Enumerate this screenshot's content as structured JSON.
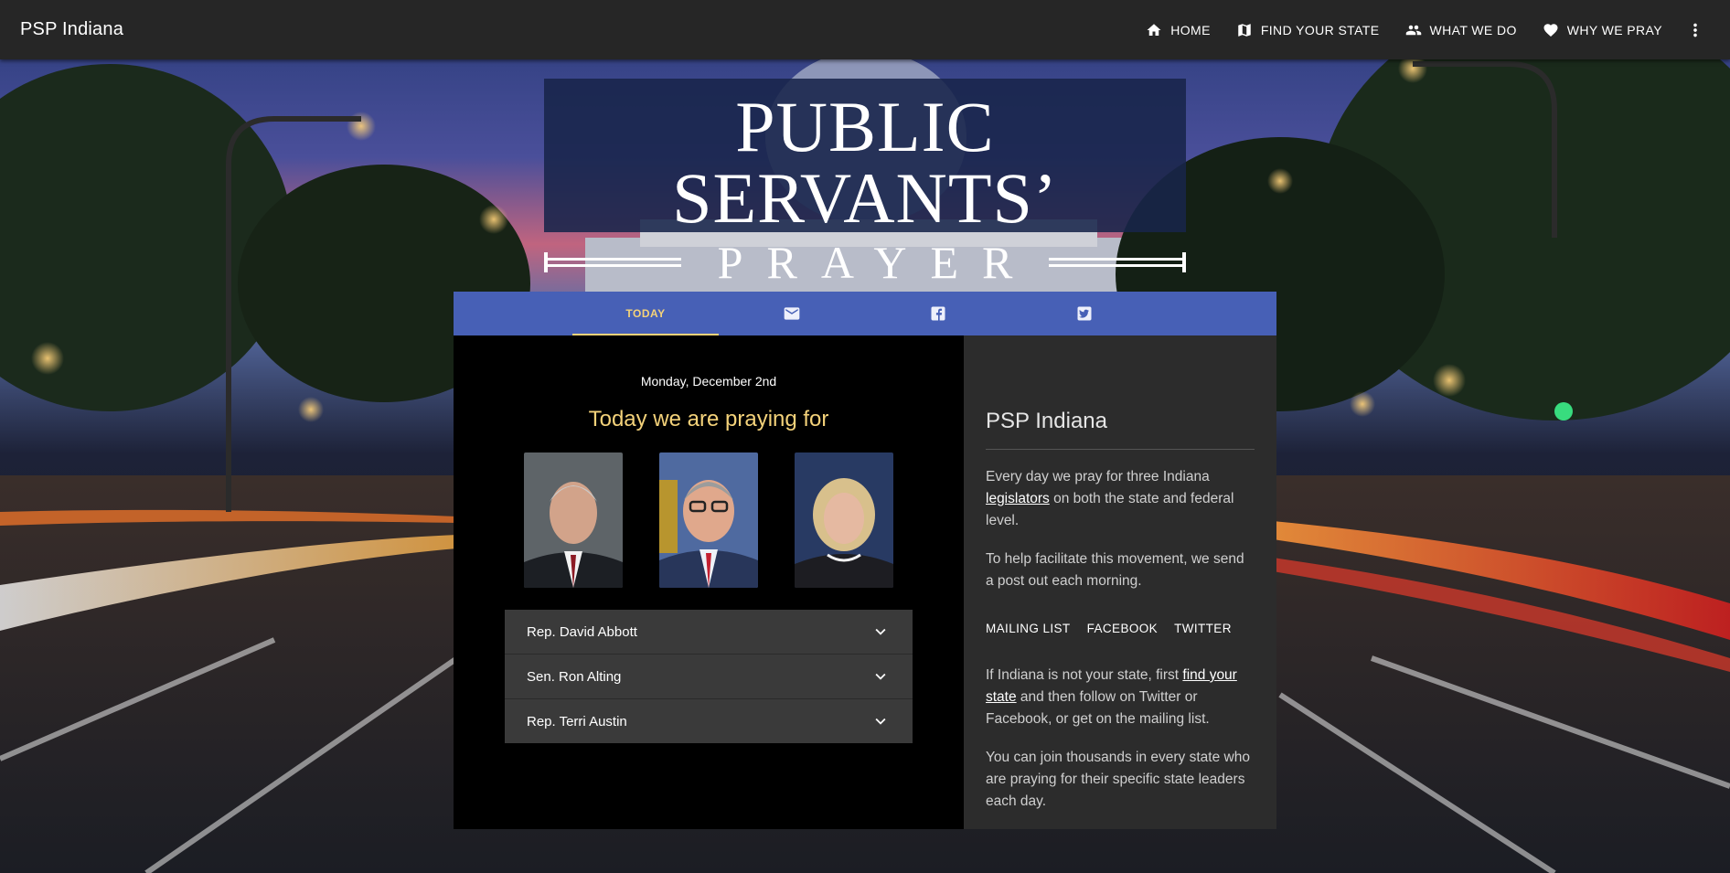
{
  "appbar": {
    "brand": "PSP Indiana",
    "nav": [
      {
        "label": "HOME",
        "icon": "home-icon"
      },
      {
        "label": "FIND YOUR STATE",
        "icon": "map-icon"
      },
      {
        "label": "WHAT WE DO",
        "icon": "people-icon"
      },
      {
        "label": "WHY WE PRAY",
        "icon": "heart-icon"
      }
    ],
    "more_icon": "more-vert-icon"
  },
  "banner": {
    "title": "PUBLIC SERVANTS’",
    "subtitle": "PRAYER"
  },
  "tabs": [
    {
      "label": "TODAY",
      "icon": null,
      "active": true
    },
    {
      "label": "",
      "icon": "mail-icon",
      "active": false
    },
    {
      "label": "",
      "icon": "facebook-icon",
      "active": false
    },
    {
      "label": "",
      "icon": "twitter-icon",
      "active": false
    }
  ],
  "today": {
    "date": "Monday, December 2nd",
    "heading": "Today we are praying for",
    "legislators": [
      {
        "name": "Rep. David Abbott"
      },
      {
        "name": "Sen. Ron Alting"
      },
      {
        "name": "Rep. Terri Austin"
      }
    ]
  },
  "sidebar": {
    "title": "PSP Indiana",
    "p1_before": "Every day we pray for three Indiana ",
    "p1_link": "legislators",
    "p1_after": " on both the state and federal level.",
    "p2": "To help facilitate this movement, we send a post out each morning.",
    "links": [
      "MAILING LIST",
      "FACEBOOK",
      "TWITTER"
    ],
    "p3_before": "If Indiana is not your state, first ",
    "p3_link": "find your state",
    "p3_after": " and then follow on Twitter or Facebook, or get on the mailing list.",
    "p4": "You can join thousands in every state who are praying for their specific state leaders each day."
  },
  "colors": {
    "appbar": "#262626",
    "tabbar": "#4760b6",
    "accent_gold": "#f4d27a",
    "left_pane": "#000000",
    "right_pane": "#2c2c2c",
    "accordion": "#3a3a3a"
  }
}
